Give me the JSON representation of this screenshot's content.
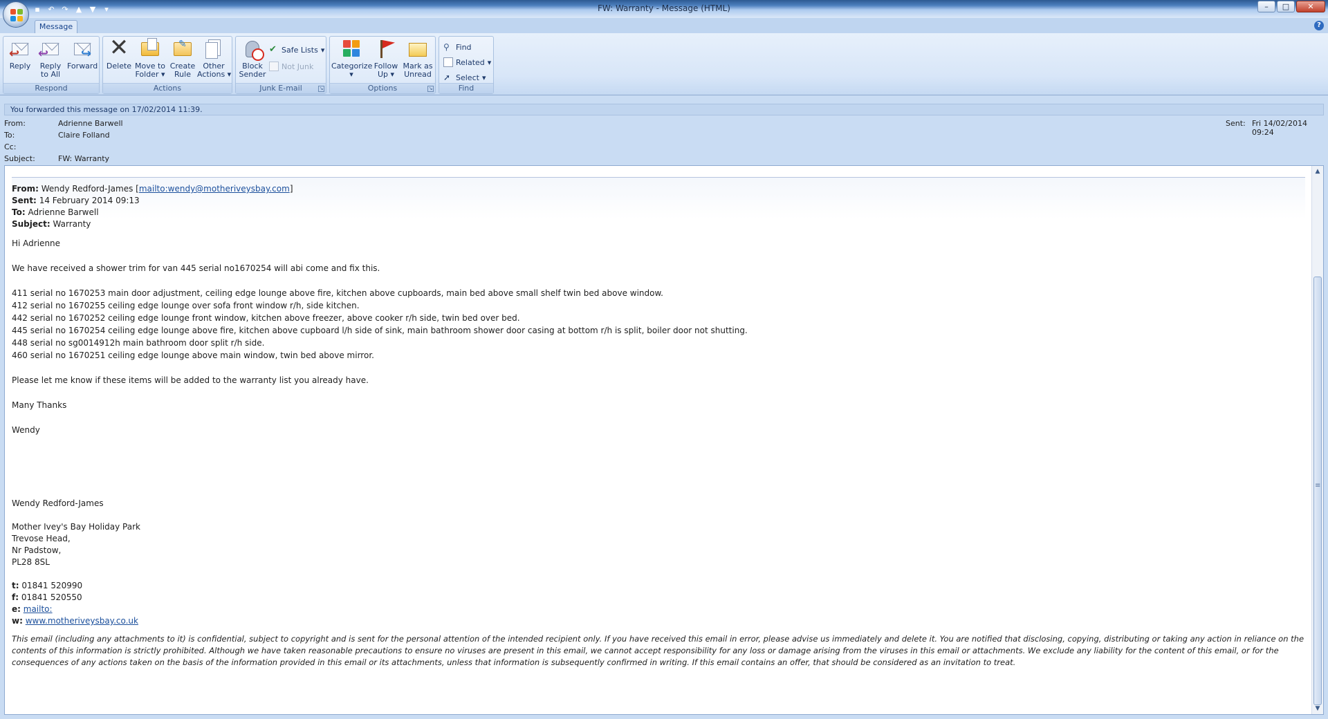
{
  "window": {
    "title": "FW: Warranty - Message (HTML)",
    "controls": [
      "–",
      "□",
      "✕"
    ]
  },
  "qat": [
    "save-icon",
    "undo-icon",
    "redo-icon",
    "up-icon",
    "down-icon",
    "customize-icon"
  ],
  "tabs": {
    "message": "Message"
  },
  "ribbon": {
    "respond": {
      "label": "Respond",
      "reply": "Reply",
      "reply_all_1": "Reply",
      "reply_all_2": "to All",
      "forward": "Forward"
    },
    "actions": {
      "label": "Actions",
      "delete": "Delete",
      "move_1": "Move to",
      "move_2": "Folder",
      "create_1": "Create",
      "create_2": "Rule",
      "other_1": "Other",
      "other_2": "Actions"
    },
    "junk": {
      "label": "Junk E-mail",
      "block_1": "Block",
      "block_2": "Sender",
      "safe_lists": "Safe Lists",
      "not_junk": "Not Junk"
    },
    "options": {
      "label": "Options",
      "categorize": "Categorize",
      "follow_1": "Follow",
      "follow_2": "Up",
      "mark_1": "Mark as",
      "mark_2": "Unread"
    },
    "find": {
      "label": "Find",
      "find": "Find",
      "related": "Related",
      "select": "Select"
    }
  },
  "infobar": "You forwarded this message on 17/02/2014 11:39.",
  "header": {
    "from_label": "From:",
    "from": "Adrienne Barwell",
    "to_label": "To:",
    "to": "Claire Folland",
    "cc_label": "Cc:",
    "cc": "",
    "subject_label": "Subject:",
    "subject": "FW: Warranty",
    "sent_label": "Sent:",
    "sent": "Fri 14/02/2014 09:24"
  },
  "message": {
    "fwd_from_label": "From:",
    "fwd_from_name": "Wendy Redford-James [",
    "fwd_from_mailto": "mailto:wendy@motheriveysbay.com",
    "fwd_from_close": "]",
    "fwd_sent_label": "Sent:",
    "fwd_sent": "14 February 2014 09:13",
    "fwd_to_label": "To:",
    "fwd_to": "Adrienne Barwell",
    "fwd_subject_label": "Subject:",
    "fwd_subject": "Warranty",
    "greeting": "Hi Adrienne",
    "intro": "We have received a shower trim for van 445  serial no1670254 will abi come and fix this.",
    "items": [
      "411 serial no 1670253 main door adjustment, ceiling edge lounge above fire, kitchen above cupboards, main bed above small shelf twin bed above window.",
      "412 serial no 1670255 ceiling edge lounge over sofa front window r/h, side kitchen.",
      "442 serial no 1670252 ceiling edge lounge front window, kitchen above freezer, above cooker r/h side, twin bed over bed.",
      "445 serial no 1670254 ceiling edge lounge above fire, kitchen above cupboard l/h side of sink, main bathroom shower door casing at bottom r/h is split, boiler door not shutting.",
      "448 serial no sg0014912h main bathroom door split r/h side.",
      "460 serial no 1670251 ceiling edge lounge above main window, twin bed above mirror."
    ],
    "request": "Please let me know if these items will be added to the warranty list you already have.",
    "thanks": "Many Thanks",
    "signoff": "Wendy",
    "sig_name": "Wendy Redford-James",
    "sig_company": "Mother Ivey's Bay Holiday Park",
    "sig_addr1": "Trevose Head,",
    "sig_addr2": "Nr Padstow,",
    "sig_addr3": "PL28 8SL",
    "tel_label": "t:",
    "tel": "01841 520990",
    "fax_label": "f:",
    "fax": "01841 520550",
    "email_label": "e:",
    "email": "mailto:",
    "web_label": "w:",
    "web": "www.motheriveysbay.co.uk",
    "disclaimer": "This email (including any attachments to it) is confidential, subject to copyright and is sent for the personal attention of the intended recipient only. If you have received this email in error, please advise us immediately and delete it. You are notified that disclosing, copying, distributing or taking any action in reliance on the contents of this information is strictly prohibited. Although we have taken reasonable precautions to ensure no viruses are present in this email, we cannot accept responsibility for any loss or damage arising from the viruses in this email or attachments. We exclude any liability for the content of this email, or for the consequences of any actions taken on the basis of the information provided in this email or its attachments, unless that information is subsequently confirmed in writing. If this email contains an offer, that should be considered as an invitation to treat."
  },
  "colors": {
    "accent": "#15428b",
    "link": "#1b4f9c",
    "ribbon": "#dbe8f8"
  }
}
